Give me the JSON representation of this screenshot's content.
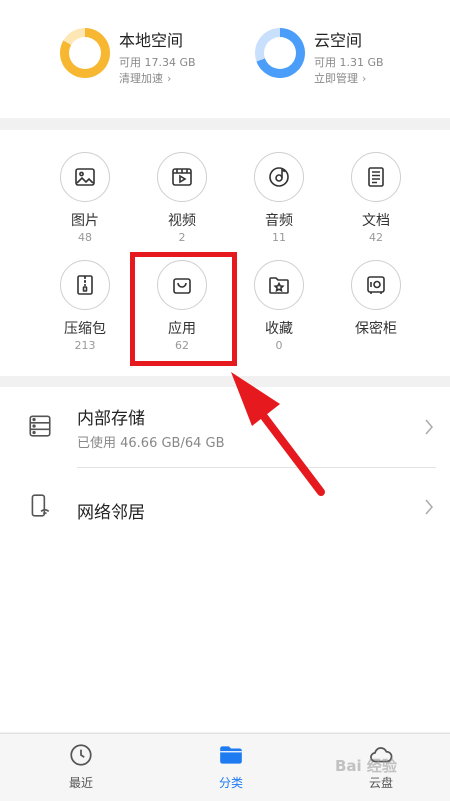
{
  "storage": {
    "local": {
      "title": "本地空间",
      "available": "可用 17.34 GB",
      "action": "清理加速"
    },
    "cloud": {
      "title": "云空间",
      "available": "可用 1.31 GB",
      "action": "立即管理"
    }
  },
  "categories": [
    {
      "label": "图片",
      "count": "48"
    },
    {
      "label": "视频",
      "count": "2"
    },
    {
      "label": "音频",
      "count": "11"
    },
    {
      "label": "文档",
      "count": "42"
    },
    {
      "label": "压缩包",
      "count": "213"
    },
    {
      "label": "应用",
      "count": "62"
    },
    {
      "label": "收藏",
      "count": "0"
    },
    {
      "label": "保密柜",
      "count": ""
    }
  ],
  "locations": {
    "internal": {
      "title": "内部存储",
      "usage": "已使用 46.66 GB/64 GB"
    },
    "network": {
      "title": "网络邻居"
    }
  },
  "tabs": [
    {
      "label": "最近"
    },
    {
      "label": "分类"
    },
    {
      "label": "云盘"
    }
  ],
  "watermark": "Bai 经验",
  "colors": {
    "local_ring": "#f7b731",
    "cloud_ring": "#4a9df8",
    "accent": "#1f7bf2",
    "highlight": "#e5191e"
  }
}
